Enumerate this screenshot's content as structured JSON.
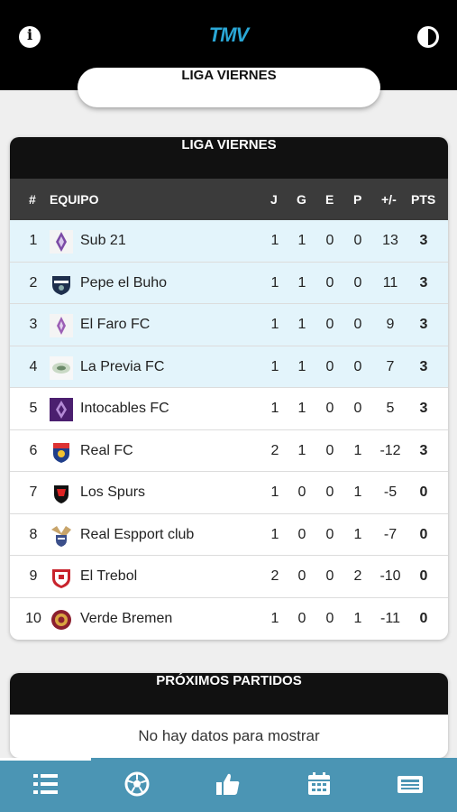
{
  "header": {
    "logo_text": "TMV",
    "info_icon": "info-icon",
    "theme_icon": "contrast-icon"
  },
  "league_selector": {
    "label": "LIGA VIERNES"
  },
  "standings": {
    "title": "LIGA VIERNES",
    "columns": [
      "#",
      "EQUIPO",
      "J",
      "G",
      "E",
      "P",
      "+/-",
      "PTS"
    ],
    "rows": [
      {
        "pos": "1",
        "team": "Sub 21",
        "j": "1",
        "g": "1",
        "e": "0",
        "p": "0",
        "dif": "13",
        "pts": "3",
        "highlight": true
      },
      {
        "pos": "2",
        "team": "Pepe el Buho",
        "j": "1",
        "g": "1",
        "e": "0",
        "p": "0",
        "dif": "11",
        "pts": "3",
        "highlight": true
      },
      {
        "pos": "3",
        "team": "El Faro FC",
        "j": "1",
        "g": "1",
        "e": "0",
        "p": "0",
        "dif": "9",
        "pts": "3",
        "highlight": true
      },
      {
        "pos": "4",
        "team": "La Previa FC",
        "j": "1",
        "g": "1",
        "e": "0",
        "p": "0",
        "dif": "7",
        "pts": "3",
        "highlight": true
      },
      {
        "pos": "5",
        "team": "Intocables FC",
        "j": "1",
        "g": "1",
        "e": "0",
        "p": "0",
        "dif": "5",
        "pts": "3",
        "highlight": false
      },
      {
        "pos": "6",
        "team": "Real FC",
        "j": "2",
        "g": "1",
        "e": "0",
        "p": "1",
        "dif": "-12",
        "pts": "3",
        "highlight": false
      },
      {
        "pos": "7",
        "team": "Los Spurs",
        "j": "1",
        "g": "0",
        "e": "0",
        "p": "1",
        "dif": "-5",
        "pts": "0",
        "highlight": false
      },
      {
        "pos": "8",
        "team": "Real Espport club",
        "j": "1",
        "g": "0",
        "e": "0",
        "p": "1",
        "dif": "-7",
        "pts": "0",
        "highlight": false
      },
      {
        "pos": "9",
        "team": "El Trebol",
        "j": "2",
        "g": "0",
        "e": "0",
        "p": "2",
        "dif": "-10",
        "pts": "0",
        "highlight": false
      },
      {
        "pos": "10",
        "team": "Verde Bremen",
        "j": "1",
        "g": "0",
        "e": "0",
        "p": "1",
        "dif": "-11",
        "pts": "0",
        "highlight": false
      }
    ]
  },
  "upcoming": {
    "title": "PRÓXIMOS PARTIDOS",
    "empty_message": "No hay datos para mostrar"
  },
  "bottom_nav": {
    "items": [
      {
        "icon": "standings-list-icon",
        "active": true
      },
      {
        "icon": "soccer-ball-icon",
        "active": false
      },
      {
        "icon": "thumbs-up-icon",
        "active": false
      },
      {
        "icon": "calendar-icon",
        "active": false
      },
      {
        "icon": "news-icon",
        "active": false
      }
    ]
  },
  "colors": {
    "accent": "#4b95b4",
    "logo": "#2aa7d6",
    "highlight_row": "#e3f4fb",
    "header_dark": "#111111"
  }
}
